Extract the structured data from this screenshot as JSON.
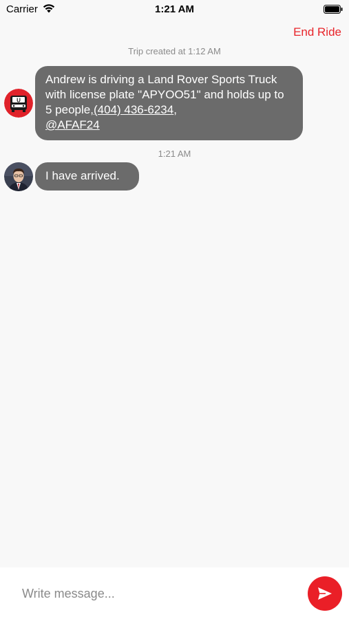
{
  "status_bar": {
    "carrier": "Carrier",
    "time": "1:21 AM",
    "icons": [
      "wifi-icon",
      "battery-icon"
    ]
  },
  "header": {
    "end_ride_label": "End Ride",
    "accent_color": "#e8242a"
  },
  "chat": {
    "trip_created": "Trip created at 1:12 AM",
    "messages": [
      {
        "sender_avatar": "bus-avatar",
        "text": "Andrew is driving a Land Rover Sports Truck with license plate \"APYOO51\" and holds up to 5 people,",
        "phone_link": "(404) 436-6234",
        "separator": ",",
        "handle_link": "@AFAF24"
      },
      {
        "timestamp": "1:21 AM",
        "sender_avatar": "driver-avatar",
        "text": "I have arrived."
      }
    ],
    "bubble_color": "#6b6b6b"
  },
  "composer": {
    "placeholder": "Write message...",
    "value": "",
    "send_icon": "send-icon",
    "send_color": "#ea1f27"
  }
}
